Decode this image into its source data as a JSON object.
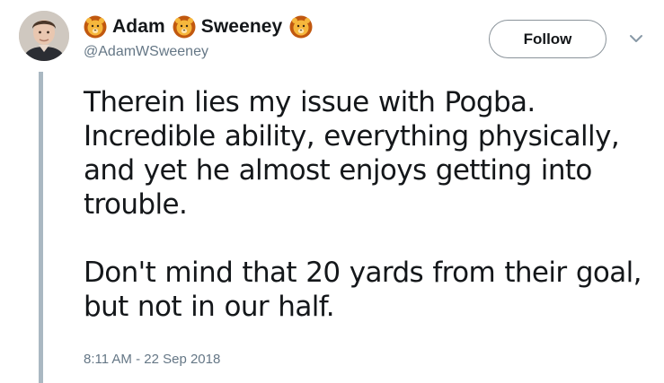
{
  "author": {
    "name_first": "Adam",
    "name_last": "Sweeney",
    "handle": "@AdamWSweeney",
    "emoji": "lion-face-emoji"
  },
  "actions": {
    "follow_label": "Follow",
    "menu_icon": "chevron-down-icon"
  },
  "tweet": {
    "paragraph_1": "Therein lies my issue with Pogba. Incredible ability, everything physically, and yet he almost enjoys getting into trouble.",
    "paragraph_2": "Don't mind that 20 yards from their goal, but not in our half.",
    "timestamp": "8:11 AM - 22 Sep 2018"
  },
  "colors": {
    "text": "#14171a",
    "secondary": "#657786",
    "thread_line": "#aab8c2",
    "lion_mane": "#c1580f",
    "lion_face": "#f6b73c"
  }
}
